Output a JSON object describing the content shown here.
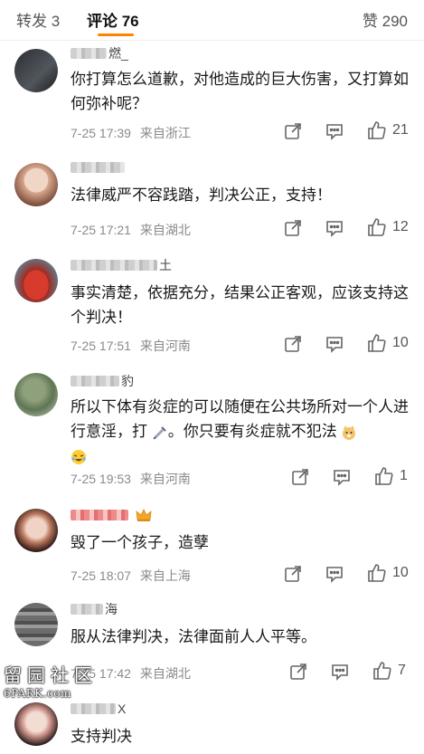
{
  "tabs": {
    "repost": "转发 3",
    "comments": "评论 76",
    "likes": "赞 290"
  },
  "colors": {
    "accent": "#ff8200"
  },
  "comments": [
    {
      "name_tail": "燃_",
      "text": "你打算怎么道歉，对他造成的巨大伤害，又打算如何弥补呢？",
      "time": "7-25 17:39",
      "location": "来自浙江",
      "likes": "21"
    },
    {
      "name_tail": "",
      "text": "法律威严不容践踏，判决公正，支持！",
      "time": "7-25 17:21",
      "location": "来自湖北",
      "likes": "12"
    },
    {
      "name_tail": "土",
      "text": "事实清楚，依据充分，结果公正客观，应该支持这个判决！",
      "time": "7-25 17:51",
      "location": "来自河南",
      "likes": "10"
    },
    {
      "name_tail": "豹",
      "text": "所以下体有炎症的可以随便在公共场所对一个人进行意淫，打",
      "text_mid": "。你只要有炎症就不犯法",
      "time": "7-25 19:53",
      "location": "来自河南",
      "likes": "1"
    },
    {
      "name_tail": "",
      "text": "毁了一个孩子，造孽",
      "time": "7-25 18:07",
      "location": "来自上海",
      "likes": "10"
    },
    {
      "name_tail": "海",
      "text": "服从法律判决，法律面前人人平等。",
      "time": "7-25 17:42",
      "location": "来自湖北",
      "likes": "7"
    },
    {
      "name_tail": "X",
      "text": "支持判决",
      "time": "",
      "location": "",
      "likes": ""
    }
  ],
  "watermark": {
    "cn": "留园社区",
    "en": "6PARK.com"
  }
}
